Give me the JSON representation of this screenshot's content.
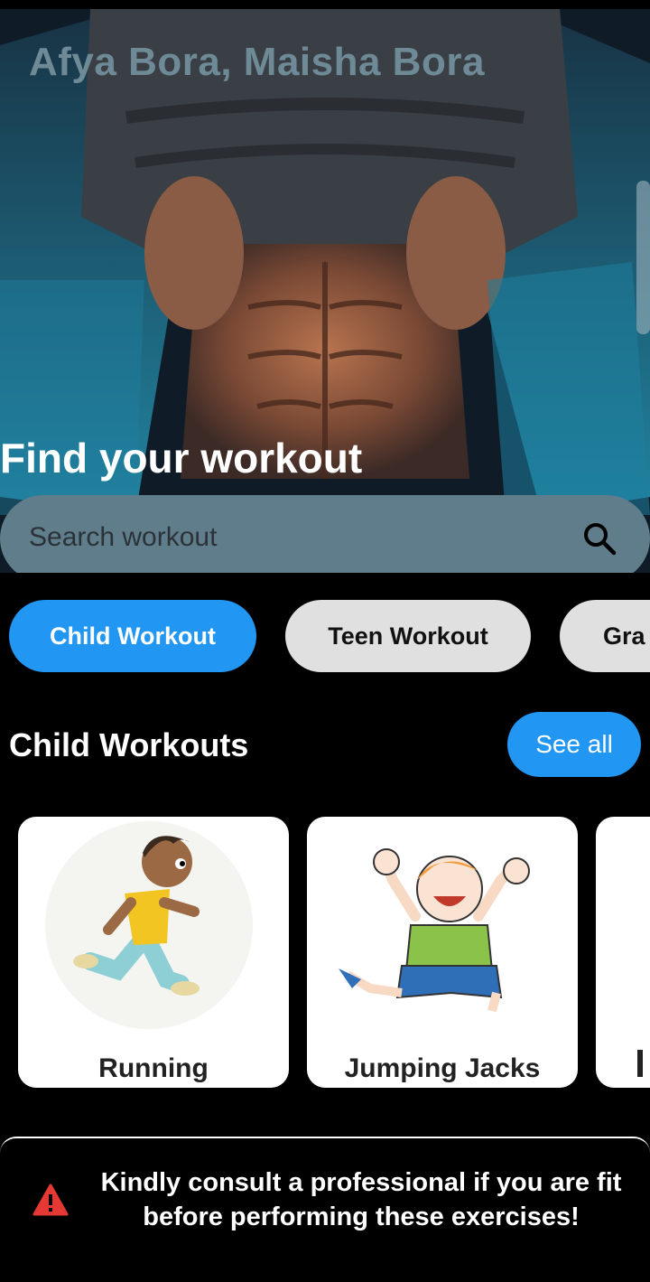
{
  "app": {
    "title": "Afya Bora, Maisha Bora"
  },
  "hero": {
    "heading": "Find your workout"
  },
  "search": {
    "placeholder": "Search workout",
    "icon": "search-icon"
  },
  "categories": [
    {
      "label": "Child Workout",
      "selected": true
    },
    {
      "label": "Teen Workout",
      "selected": false
    },
    {
      "label": "Gra",
      "selected": false
    }
  ],
  "section": {
    "title": "Child Workouts",
    "see_all_label": "See all"
  },
  "workouts": [
    {
      "label": "Running"
    },
    {
      "label": "Jumping Jacks"
    }
  ],
  "notice": {
    "icon": "warning-icon",
    "text": "Kindly consult a professional if you are fit before performing these exercises!"
  },
  "colors": {
    "accent": "#2196f3",
    "chip_inactive": "#e0e0e0",
    "search_bg": "#607d8b",
    "warning": "#e53935"
  }
}
